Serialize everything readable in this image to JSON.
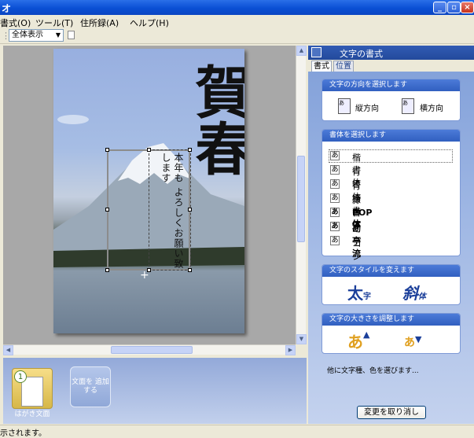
{
  "window": {
    "title": "オ"
  },
  "menu": [
    "書式(O)",
    "ツール(T)",
    "住所録(A)",
    "ヘルプ(H)"
  ],
  "toolbar": {
    "zoom_value": "全体表示"
  },
  "card": {
    "kanji": "賀春",
    "message": "本年も よろしくお願い致します"
  },
  "thumbs": {
    "page_number": "1",
    "page_label": "はがき文面",
    "add_label": "文面を 追加する"
  },
  "panel": {
    "title": "文字の書式",
    "tabs": [
      "書式",
      "位置"
    ],
    "direction": {
      "heading": "文字の方向を選択します",
      "vertical": "縦方向",
      "horizontal": "横方向"
    },
    "fonts": {
      "heading": "書体を選択します",
      "items": [
        "楷書体",
        "行書体",
        "行楷書体",
        "隷書体",
        "POP体",
        "勘亭流",
        "ゴシック体"
      ],
      "icon_char": "あ"
    },
    "style": {
      "heading": "文字のスタイルを変えます",
      "bold_big": "太",
      "bold_small": "字",
      "italic_big": "斜",
      "italic_small": "体"
    },
    "size": {
      "heading": "文字の大きさを調整します",
      "glyph": "あ"
    },
    "note": "他に文字種、色を選びます...",
    "apply_button": "変更を取り消し"
  },
  "status": {
    "text": "示されます。"
  }
}
